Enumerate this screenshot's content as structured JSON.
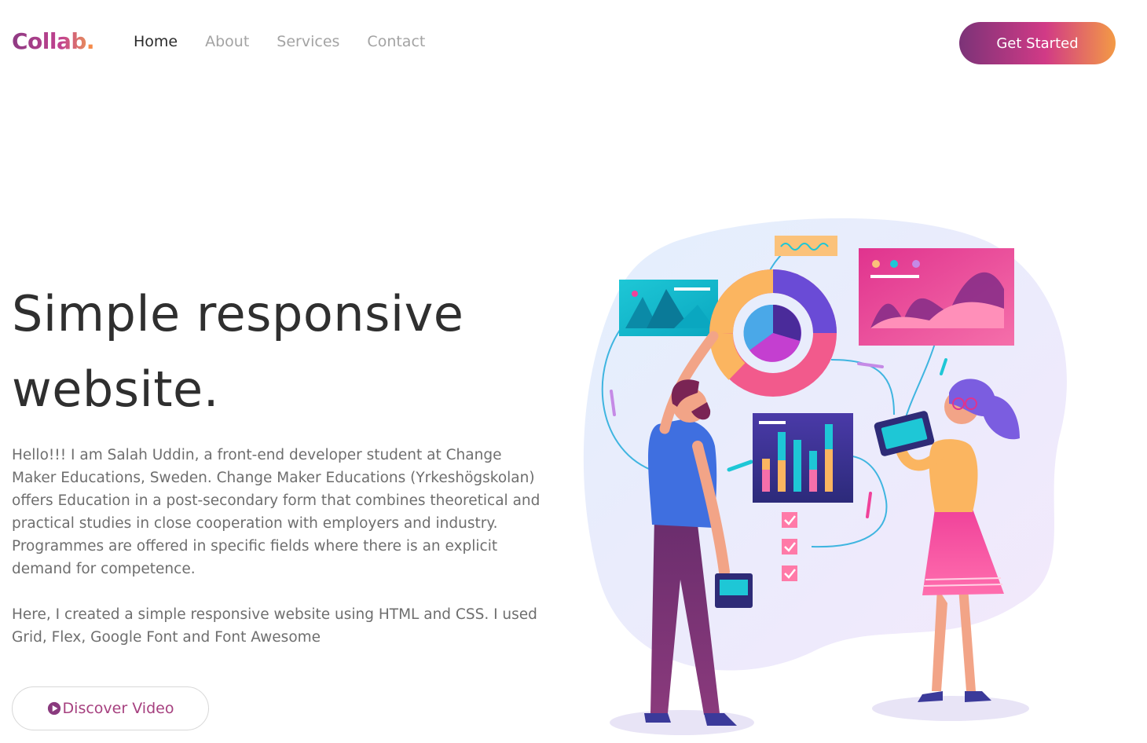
{
  "brand": {
    "name": "Collab",
    "dot": "."
  },
  "nav": {
    "items": [
      {
        "label": "Home",
        "active": true
      },
      {
        "label": "About",
        "active": false
      },
      {
        "label": "Services",
        "active": false
      },
      {
        "label": "Contact",
        "active": false
      }
    ]
  },
  "header": {
    "cta_label": "Get Started"
  },
  "hero": {
    "title_line1": "Simple responsive",
    "title_line2": "website.",
    "paragraph1": "Hello!!! I am Salah Uddin, a front-end developer student at Change Maker Educations, Sweden. Change Maker Educations (Yrkeshögskolan) offers Education in a post-secondary form that combines theoretical and practical studies in close cooperation with employers and industry. Programmes are offered in specific fields where there is an explicit demand for competence.",
    "paragraph2": "Here, I created a simple responsive website using HTML and CSS. I used Grid, Flex, Google Font and Font Awesome",
    "video_button_label": "Discover Video",
    "video_icon": "play-circle-icon"
  },
  "colors": {
    "brand_start": "#8e3a83",
    "brand_mid": "#d13a86",
    "brand_end": "#f39a45",
    "text_dark": "#2f2f2f",
    "text_muted": "#6e6e6e",
    "nav_inactive": "#a3a3a3"
  }
}
